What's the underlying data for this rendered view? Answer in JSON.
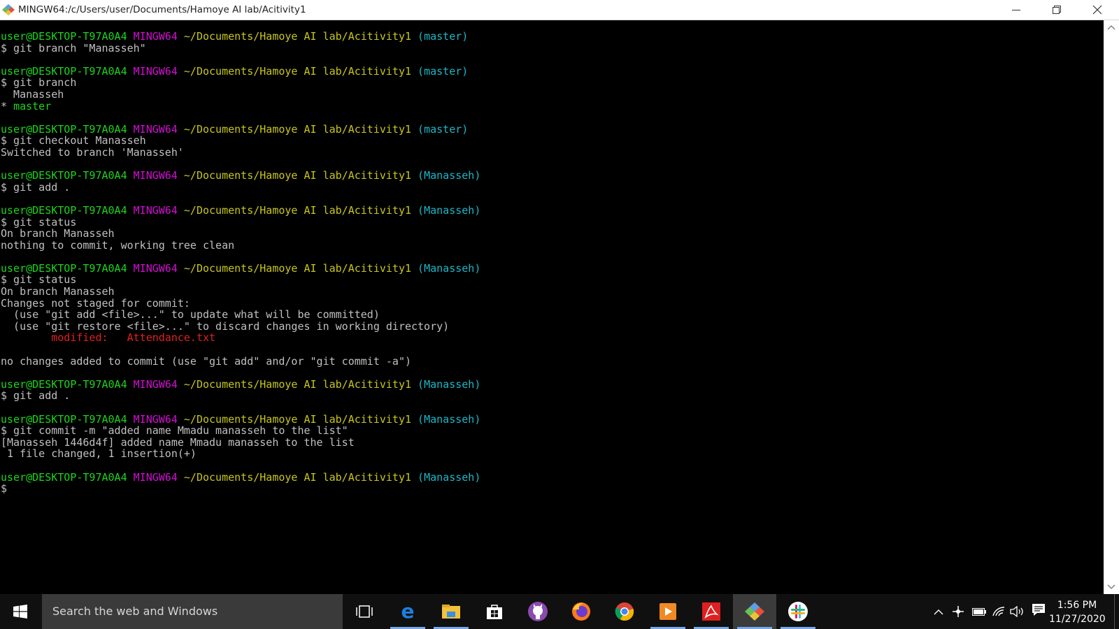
{
  "window": {
    "title": "MINGW64:/c/Users/user/Documents/Hamoye AI lab/Acitivity1",
    "app_icon": "git-bash-icon",
    "controls": [
      "minimize-icon",
      "maximize-icon",
      "close-icon"
    ]
  },
  "colors": {
    "prompt_user": "#1bd51b",
    "prompt_env": "#d30ed3",
    "prompt_path": "#c8c61a",
    "prompt_branch": "#1bb8c8",
    "modified": "#e02020",
    "text": "#c0c0c0"
  },
  "terminal": {
    "lines": [
      [
        {
          "t": "user@DESKTOP-T97A0A4",
          "c": "green"
        },
        {
          "t": " ",
          "c": "white"
        },
        {
          "t": "MINGW64",
          "c": "mag"
        },
        {
          "t": " ",
          "c": "white"
        },
        {
          "t": "~/Documents/Hamoye AI lab/Acitivity1",
          "c": "yel"
        },
        {
          "t": " ",
          "c": "white"
        },
        {
          "t": "(master)",
          "c": "cyan"
        }
      ],
      [
        {
          "t": "$ git branch \"Manasseh\"",
          "c": "white"
        }
      ],
      [
        {
          "t": "",
          "c": "white"
        }
      ],
      [
        {
          "t": "user@DESKTOP-T97A0A4",
          "c": "green"
        },
        {
          "t": " ",
          "c": "white"
        },
        {
          "t": "MINGW64",
          "c": "mag"
        },
        {
          "t": " ",
          "c": "white"
        },
        {
          "t": "~/Documents/Hamoye AI lab/Acitivity1",
          "c": "yel"
        },
        {
          "t": " ",
          "c": "white"
        },
        {
          "t": "(master)",
          "c": "cyan"
        }
      ],
      [
        {
          "t": "$ git branch",
          "c": "white"
        }
      ],
      [
        {
          "t": "  Manasseh",
          "c": "white"
        }
      ],
      [
        {
          "t": "* ",
          "c": "white"
        },
        {
          "t": "master",
          "c": "green"
        }
      ],
      [
        {
          "t": "",
          "c": "white"
        }
      ],
      [
        {
          "t": "user@DESKTOP-T97A0A4",
          "c": "green"
        },
        {
          "t": " ",
          "c": "white"
        },
        {
          "t": "MINGW64",
          "c": "mag"
        },
        {
          "t": " ",
          "c": "white"
        },
        {
          "t": "~/Documents/Hamoye AI lab/Acitivity1",
          "c": "yel"
        },
        {
          "t": " ",
          "c": "white"
        },
        {
          "t": "(master)",
          "c": "cyan"
        }
      ],
      [
        {
          "t": "$ git checkout Manasseh",
          "c": "white"
        }
      ],
      [
        {
          "t": "Switched to branch 'Manasseh'",
          "c": "white"
        }
      ],
      [
        {
          "t": "",
          "c": "white"
        }
      ],
      [
        {
          "t": "user@DESKTOP-T97A0A4",
          "c": "green"
        },
        {
          "t": " ",
          "c": "white"
        },
        {
          "t": "MINGW64",
          "c": "mag"
        },
        {
          "t": " ",
          "c": "white"
        },
        {
          "t": "~/Documents/Hamoye AI lab/Acitivity1",
          "c": "yel"
        },
        {
          "t": " ",
          "c": "white"
        },
        {
          "t": "(Manasseh)",
          "c": "cyan"
        }
      ],
      [
        {
          "t": "$ git add .",
          "c": "white"
        }
      ],
      [
        {
          "t": "",
          "c": "white"
        }
      ],
      [
        {
          "t": "user@DESKTOP-T97A0A4",
          "c": "green"
        },
        {
          "t": " ",
          "c": "white"
        },
        {
          "t": "MINGW64",
          "c": "mag"
        },
        {
          "t": " ",
          "c": "white"
        },
        {
          "t": "~/Documents/Hamoye AI lab/Acitivity1",
          "c": "yel"
        },
        {
          "t": " ",
          "c": "white"
        },
        {
          "t": "(Manasseh)",
          "c": "cyan"
        }
      ],
      [
        {
          "t": "$ git status",
          "c": "white"
        }
      ],
      [
        {
          "t": "On branch Manasseh",
          "c": "white"
        }
      ],
      [
        {
          "t": "nothing to commit, working tree clean",
          "c": "white"
        }
      ],
      [
        {
          "t": "",
          "c": "white"
        }
      ],
      [
        {
          "t": "user@DESKTOP-T97A0A4",
          "c": "green"
        },
        {
          "t": " ",
          "c": "white"
        },
        {
          "t": "MINGW64",
          "c": "mag"
        },
        {
          "t": " ",
          "c": "white"
        },
        {
          "t": "~/Documents/Hamoye AI lab/Acitivity1",
          "c": "yel"
        },
        {
          "t": " ",
          "c": "white"
        },
        {
          "t": "(Manasseh)",
          "c": "cyan"
        }
      ],
      [
        {
          "t": "$ git status",
          "c": "white"
        }
      ],
      [
        {
          "t": "On branch Manasseh",
          "c": "white"
        }
      ],
      [
        {
          "t": "Changes not staged for commit:",
          "c": "white"
        }
      ],
      [
        {
          "t": "  (use \"git add <file>...\" to update what will be committed)",
          "c": "white"
        }
      ],
      [
        {
          "t": "  (use \"git restore <file>...\" to discard changes in working directory)",
          "c": "white"
        }
      ],
      [
        {
          "t": "        modified:   Attendance.txt",
          "c": "red"
        }
      ],
      [
        {
          "t": "",
          "c": "white"
        }
      ],
      [
        {
          "t": "no changes added to commit (use \"git add\" and/or \"git commit -a\")",
          "c": "white"
        }
      ],
      [
        {
          "t": "",
          "c": "white"
        }
      ],
      [
        {
          "t": "user@DESKTOP-T97A0A4",
          "c": "green"
        },
        {
          "t": " ",
          "c": "white"
        },
        {
          "t": "MINGW64",
          "c": "mag"
        },
        {
          "t": " ",
          "c": "white"
        },
        {
          "t": "~/Documents/Hamoye AI lab/Acitivity1",
          "c": "yel"
        },
        {
          "t": " ",
          "c": "white"
        },
        {
          "t": "(Manasseh)",
          "c": "cyan"
        }
      ],
      [
        {
          "t": "$ git add .",
          "c": "white"
        }
      ],
      [
        {
          "t": "",
          "c": "white"
        }
      ],
      [
        {
          "t": "user@DESKTOP-T97A0A4",
          "c": "green"
        },
        {
          "t": " ",
          "c": "white"
        },
        {
          "t": "MINGW64",
          "c": "mag"
        },
        {
          "t": " ",
          "c": "white"
        },
        {
          "t": "~/Documents/Hamoye AI lab/Acitivity1",
          "c": "yel"
        },
        {
          "t": " ",
          "c": "white"
        },
        {
          "t": "(Manasseh)",
          "c": "cyan"
        }
      ],
      [
        {
          "t": "$ git commit -m \"added name Mmadu manasseh to the list\"",
          "c": "white"
        }
      ],
      [
        {
          "t": "[Manasseh 1446d4f] added name Mmadu manasseh to the list",
          "c": "white"
        }
      ],
      [
        {
          "t": " 1 file changed, 1 insertion(+)",
          "c": "white"
        }
      ],
      [
        {
          "t": "",
          "c": "white"
        }
      ],
      [
        {
          "t": "user@DESKTOP-T97A0A4",
          "c": "green"
        },
        {
          "t": " ",
          "c": "white"
        },
        {
          "t": "MINGW64",
          "c": "mag"
        },
        {
          "t": " ",
          "c": "white"
        },
        {
          "t": "~/Documents/Hamoye AI lab/Acitivity1",
          "c": "yel"
        },
        {
          "t": " ",
          "c": "white"
        },
        {
          "t": "(Manasseh)",
          "c": "cyan"
        }
      ],
      [
        {
          "t": "$",
          "c": "white"
        }
      ]
    ]
  },
  "taskbar": {
    "search_placeholder": "Search the web and Windows",
    "start_icon": "windows-start-icon",
    "pinned": [
      {
        "name": "task-view-icon"
      },
      {
        "name": "edge-icon"
      },
      {
        "name": "file-explorer-icon"
      },
      {
        "name": "store-icon"
      },
      {
        "name": "github-desktop-icon"
      },
      {
        "name": "firefox-icon"
      },
      {
        "name": "chrome-icon"
      },
      {
        "name": "media-player-icon"
      },
      {
        "name": "acrobat-icon"
      },
      {
        "name": "git-bash-icon"
      },
      {
        "name": "slack-icon"
      }
    ],
    "tray": [
      "chevron-up-icon",
      "network-share-icon",
      "battery-icon",
      "wifi-icon",
      "volume-icon"
    ],
    "time": "1:56 PM",
    "date": "11/27/2020"
  }
}
